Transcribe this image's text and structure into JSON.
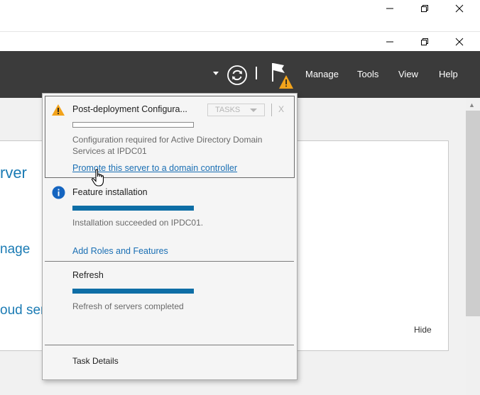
{
  "outer_window": {
    "controls": [
      "minimize",
      "restore",
      "close"
    ]
  },
  "inner_window": {
    "controls": [
      "minimize",
      "restore",
      "close"
    ]
  },
  "header": {
    "menu": {
      "manage": "Manage",
      "tools": "Tools",
      "view": "View",
      "help": "Help"
    },
    "icons": {
      "refresh": "refresh-icon",
      "flag": "notification-flag-icon",
      "warning": "warning-icon"
    }
  },
  "background": {
    "title_fragment": "rver",
    "manage_fragment": "nage",
    "cloud_fragment": "oud ser",
    "hide_label": "Hide"
  },
  "notifications": [
    {
      "icon": "warning-icon",
      "title": "Post-deployment Configura...",
      "tasks_label": "TASKS",
      "close_label": "X",
      "progress": 0,
      "message": "Configuration required for Active Directory Domain Services at IPDC01",
      "link": "Promote this server to a domain controller"
    },
    {
      "icon": "info-icon",
      "title": "Feature installation",
      "progress": 1,
      "message": "Installation succeeded on IPDC01.",
      "link": "Add Roles and Features"
    },
    {
      "title": "Refresh",
      "progress": 1,
      "message": "Refresh of servers completed"
    }
  ],
  "footer": {
    "task_details": "Task Details"
  },
  "colors": {
    "header_bg": "#3b3b3b",
    "progress": "#0e6ea6",
    "link": "#1a6fb4",
    "warning": "#f2a31b",
    "info": "#1565c0"
  }
}
